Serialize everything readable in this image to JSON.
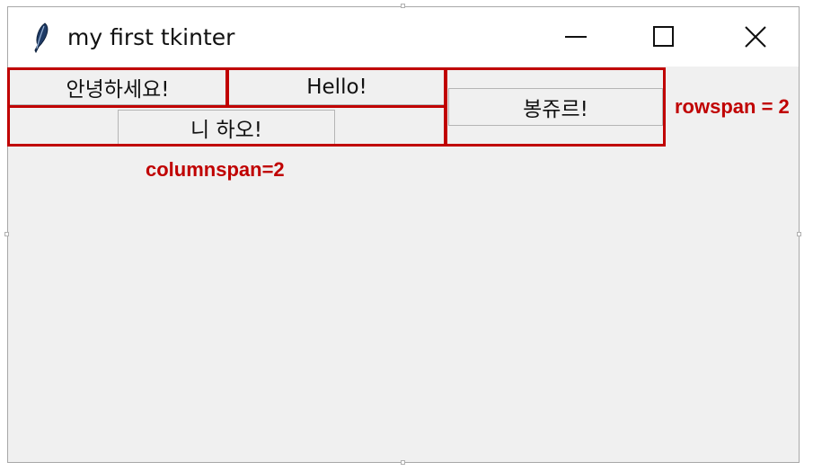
{
  "window": {
    "title": "my first tkinter",
    "app_icon": "feather-icon",
    "controls": {
      "minimize": "minimize-icon",
      "maximize": "maximize-icon",
      "close": "close-icon"
    }
  },
  "buttons": {
    "hello_kr": "안녕하세요!",
    "hello_en": "Hello!",
    "ni_hao": "니 하오!",
    "bonjour": "봉쥬르!"
  },
  "annotations": {
    "columnspan": "columnspan=2",
    "rowspan": "rowspan = 2"
  },
  "colors": {
    "annotation": "#c00000",
    "window_bg": "#f0f0f0",
    "titlebar_bg": "#ffffff"
  }
}
